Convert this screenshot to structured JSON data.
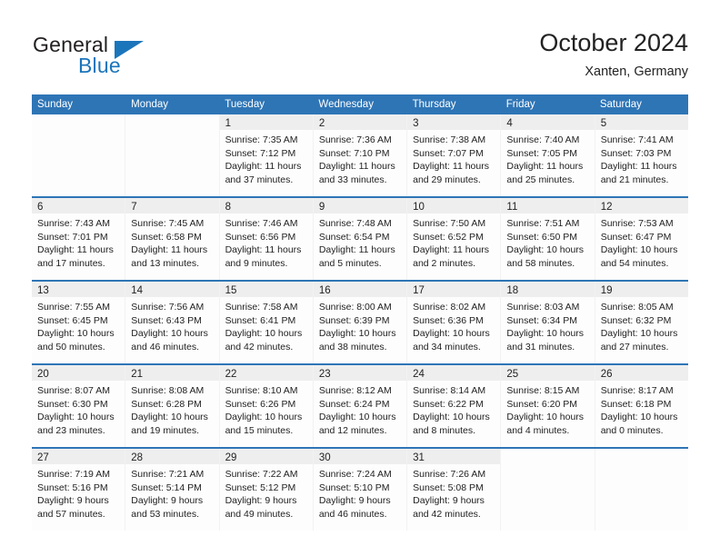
{
  "brand": {
    "name_part1": "General",
    "name_part2": "Blue",
    "triangle_icon": "triangle-icon",
    "accent_color": "#1b75bb"
  },
  "header": {
    "title": "October 2024",
    "subtitle": "Xanten, Germany"
  },
  "calendar": {
    "header_color": "#2e75b6",
    "weekdays": [
      "Sunday",
      "Monday",
      "Tuesday",
      "Wednesday",
      "Thursday",
      "Friday",
      "Saturday"
    ],
    "weeks": [
      [
        {
          "day": "",
          "lines": []
        },
        {
          "day": "",
          "lines": []
        },
        {
          "day": "1",
          "lines": [
            "Sunrise: 7:35 AM",
            "Sunset: 7:12 PM",
            "Daylight: 11 hours",
            "and 37 minutes."
          ]
        },
        {
          "day": "2",
          "lines": [
            "Sunrise: 7:36 AM",
            "Sunset: 7:10 PM",
            "Daylight: 11 hours",
            "and 33 minutes."
          ]
        },
        {
          "day": "3",
          "lines": [
            "Sunrise: 7:38 AM",
            "Sunset: 7:07 PM",
            "Daylight: 11 hours",
            "and 29 minutes."
          ]
        },
        {
          "day": "4",
          "lines": [
            "Sunrise: 7:40 AM",
            "Sunset: 7:05 PM",
            "Daylight: 11 hours",
            "and 25 minutes."
          ]
        },
        {
          "day": "5",
          "lines": [
            "Sunrise: 7:41 AM",
            "Sunset: 7:03 PM",
            "Daylight: 11 hours",
            "and 21 minutes."
          ]
        }
      ],
      [
        {
          "day": "6",
          "lines": [
            "Sunrise: 7:43 AM",
            "Sunset: 7:01 PM",
            "Daylight: 11 hours",
            "and 17 minutes."
          ]
        },
        {
          "day": "7",
          "lines": [
            "Sunrise: 7:45 AM",
            "Sunset: 6:58 PM",
            "Daylight: 11 hours",
            "and 13 minutes."
          ]
        },
        {
          "day": "8",
          "lines": [
            "Sunrise: 7:46 AM",
            "Sunset: 6:56 PM",
            "Daylight: 11 hours",
            "and 9 minutes."
          ]
        },
        {
          "day": "9",
          "lines": [
            "Sunrise: 7:48 AM",
            "Sunset: 6:54 PM",
            "Daylight: 11 hours",
            "and 5 minutes."
          ]
        },
        {
          "day": "10",
          "lines": [
            "Sunrise: 7:50 AM",
            "Sunset: 6:52 PM",
            "Daylight: 11 hours",
            "and 2 minutes."
          ]
        },
        {
          "day": "11",
          "lines": [
            "Sunrise: 7:51 AM",
            "Sunset: 6:50 PM",
            "Daylight: 10 hours",
            "and 58 minutes."
          ]
        },
        {
          "day": "12",
          "lines": [
            "Sunrise: 7:53 AM",
            "Sunset: 6:47 PM",
            "Daylight: 10 hours",
            "and 54 minutes."
          ]
        }
      ],
      [
        {
          "day": "13",
          "lines": [
            "Sunrise: 7:55 AM",
            "Sunset: 6:45 PM",
            "Daylight: 10 hours",
            "and 50 minutes."
          ]
        },
        {
          "day": "14",
          "lines": [
            "Sunrise: 7:56 AM",
            "Sunset: 6:43 PM",
            "Daylight: 10 hours",
            "and 46 minutes."
          ]
        },
        {
          "day": "15",
          "lines": [
            "Sunrise: 7:58 AM",
            "Sunset: 6:41 PM",
            "Daylight: 10 hours",
            "and 42 minutes."
          ]
        },
        {
          "day": "16",
          "lines": [
            "Sunrise: 8:00 AM",
            "Sunset: 6:39 PM",
            "Daylight: 10 hours",
            "and 38 minutes."
          ]
        },
        {
          "day": "17",
          "lines": [
            "Sunrise: 8:02 AM",
            "Sunset: 6:36 PM",
            "Daylight: 10 hours",
            "and 34 minutes."
          ]
        },
        {
          "day": "18",
          "lines": [
            "Sunrise: 8:03 AM",
            "Sunset: 6:34 PM",
            "Daylight: 10 hours",
            "and 31 minutes."
          ]
        },
        {
          "day": "19",
          "lines": [
            "Sunrise: 8:05 AM",
            "Sunset: 6:32 PM",
            "Daylight: 10 hours",
            "and 27 minutes."
          ]
        }
      ],
      [
        {
          "day": "20",
          "lines": [
            "Sunrise: 8:07 AM",
            "Sunset: 6:30 PM",
            "Daylight: 10 hours",
            "and 23 minutes."
          ]
        },
        {
          "day": "21",
          "lines": [
            "Sunrise: 8:08 AM",
            "Sunset: 6:28 PM",
            "Daylight: 10 hours",
            "and 19 minutes."
          ]
        },
        {
          "day": "22",
          "lines": [
            "Sunrise: 8:10 AM",
            "Sunset: 6:26 PM",
            "Daylight: 10 hours",
            "and 15 minutes."
          ]
        },
        {
          "day": "23",
          "lines": [
            "Sunrise: 8:12 AM",
            "Sunset: 6:24 PM",
            "Daylight: 10 hours",
            "and 12 minutes."
          ]
        },
        {
          "day": "24",
          "lines": [
            "Sunrise: 8:14 AM",
            "Sunset: 6:22 PM",
            "Daylight: 10 hours",
            "and 8 minutes."
          ]
        },
        {
          "day": "25",
          "lines": [
            "Sunrise: 8:15 AM",
            "Sunset: 6:20 PM",
            "Daylight: 10 hours",
            "and 4 minutes."
          ]
        },
        {
          "day": "26",
          "lines": [
            "Sunrise: 8:17 AM",
            "Sunset: 6:18 PM",
            "Daylight: 10 hours",
            "and 0 minutes."
          ]
        }
      ],
      [
        {
          "day": "27",
          "lines": [
            "Sunrise: 7:19 AM",
            "Sunset: 5:16 PM",
            "Daylight: 9 hours",
            "and 57 minutes."
          ]
        },
        {
          "day": "28",
          "lines": [
            "Sunrise: 7:21 AM",
            "Sunset: 5:14 PM",
            "Daylight: 9 hours",
            "and 53 minutes."
          ]
        },
        {
          "day": "29",
          "lines": [
            "Sunrise: 7:22 AM",
            "Sunset: 5:12 PM",
            "Daylight: 9 hours",
            "and 49 minutes."
          ]
        },
        {
          "day": "30",
          "lines": [
            "Sunrise: 7:24 AM",
            "Sunset: 5:10 PM",
            "Daylight: 9 hours",
            "and 46 minutes."
          ]
        },
        {
          "day": "31",
          "lines": [
            "Sunrise: 7:26 AM",
            "Sunset: 5:08 PM",
            "Daylight: 9 hours",
            "and 42 minutes."
          ]
        },
        {
          "day": "",
          "lines": []
        },
        {
          "day": "",
          "lines": []
        }
      ]
    ]
  }
}
